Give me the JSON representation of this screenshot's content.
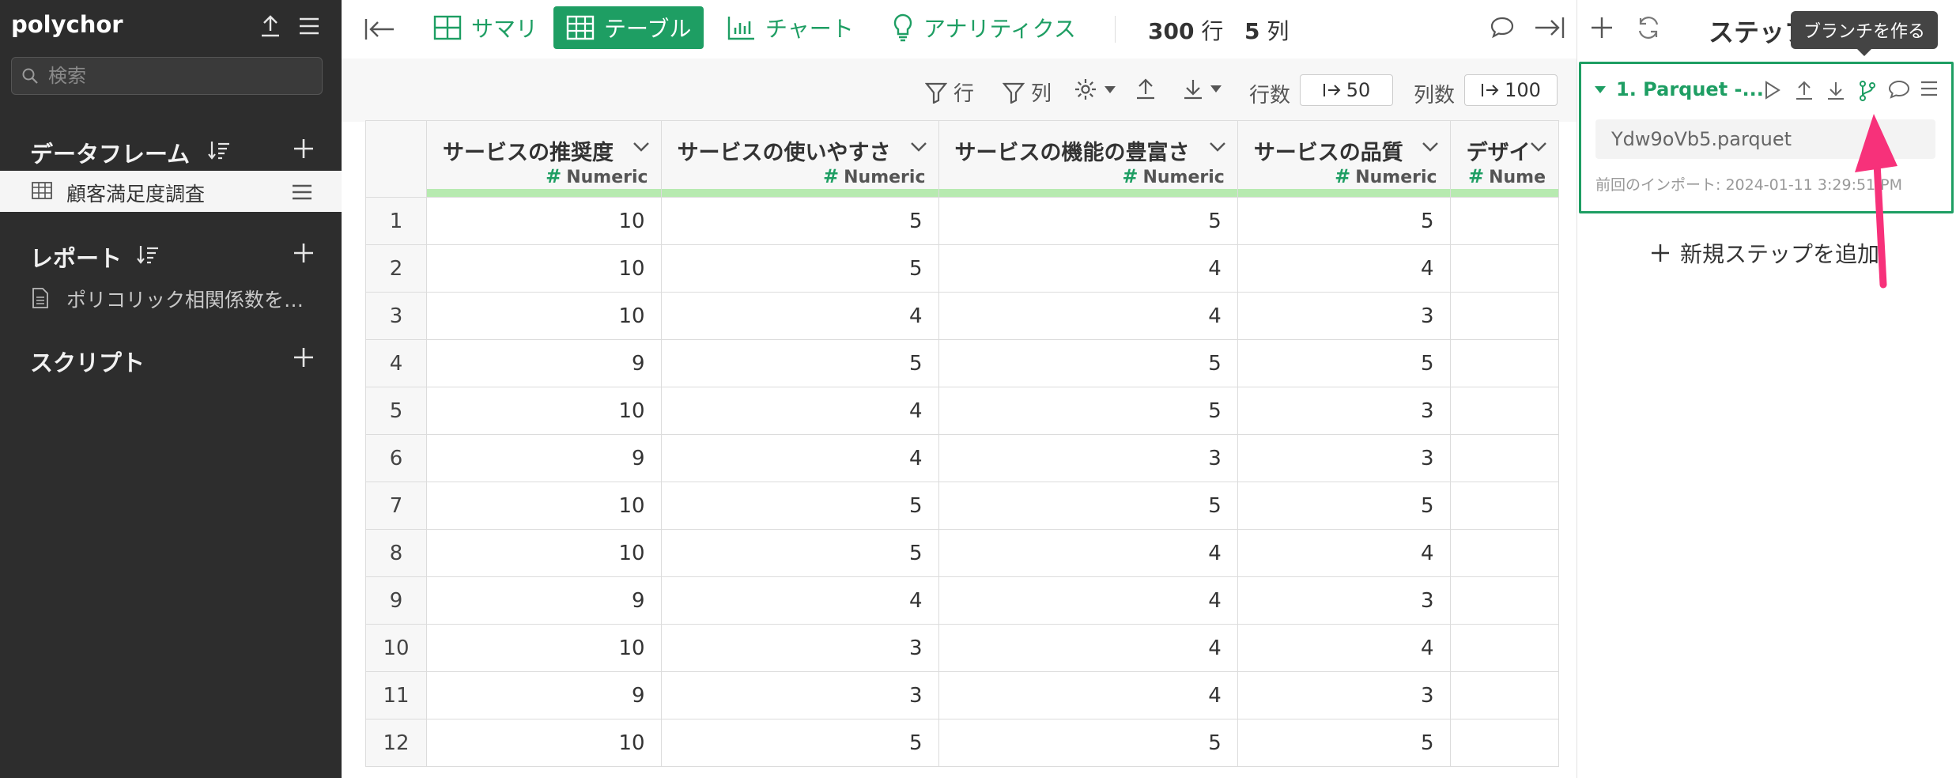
{
  "app": {
    "name": "polychor"
  },
  "sidebar": {
    "search_placeholder": "検索",
    "dataframes": {
      "title": "データフレーム",
      "items": [
        {
          "label": "顧客満足度調査"
        }
      ]
    },
    "reports": {
      "title": "レポート",
      "items": [
        {
          "label": "ポリコリック相関係数を…"
        }
      ]
    },
    "scripts": {
      "title": "スクリプト"
    }
  },
  "tabs": [
    {
      "label": "サマリ",
      "icon": "grid-icon",
      "active": false
    },
    {
      "label": "テーブル",
      "icon": "table-icon",
      "active": true
    },
    {
      "label": "チャート",
      "icon": "bar-chart-icon",
      "active": false
    },
    {
      "label": "アナリティクス",
      "icon": "lightbulb-icon",
      "active": false
    }
  ],
  "stats": {
    "rows_value": "300",
    "rows_unit": "行",
    "cols_value": "5",
    "cols_unit": "列"
  },
  "toolbar": {
    "row_filter": "行",
    "col_filter": "列",
    "rows_label": "行数",
    "rows_value": "50",
    "cols_label": "列数",
    "cols_value": "100"
  },
  "table": {
    "columns": [
      {
        "name": "サービスの推奨度",
        "type": "Numeric"
      },
      {
        "name": "サービスの使いやすさ",
        "type": "Numeric"
      },
      {
        "name": "サービスの機能の豊富さ",
        "type": "Numeric"
      },
      {
        "name": "サービスの品質",
        "type": "Numeric"
      },
      {
        "name": "デザイ",
        "type": "Nume"
      }
    ],
    "type_hash": "#",
    "rows": [
      {
        "index": "1",
        "cells": [
          "10",
          "5",
          "5",
          "5",
          ""
        ]
      },
      {
        "index": "2",
        "cells": [
          "10",
          "5",
          "4",
          "4",
          ""
        ]
      },
      {
        "index": "3",
        "cells": [
          "10",
          "4",
          "4",
          "3",
          ""
        ]
      },
      {
        "index": "4",
        "cells": [
          "9",
          "5",
          "5",
          "5",
          ""
        ]
      },
      {
        "index": "5",
        "cells": [
          "10",
          "4",
          "5",
          "3",
          ""
        ]
      },
      {
        "index": "6",
        "cells": [
          "9",
          "4",
          "3",
          "3",
          ""
        ]
      },
      {
        "index": "7",
        "cells": [
          "10",
          "5",
          "5",
          "5",
          ""
        ]
      },
      {
        "index": "8",
        "cells": [
          "10",
          "5",
          "4",
          "4",
          ""
        ]
      },
      {
        "index": "9",
        "cells": [
          "9",
          "4",
          "4",
          "3",
          ""
        ]
      },
      {
        "index": "10",
        "cells": [
          "10",
          "3",
          "4",
          "4",
          ""
        ]
      },
      {
        "index": "11",
        "cells": [
          "9",
          "3",
          "4",
          "3",
          ""
        ]
      },
      {
        "index": "12",
        "cells": [
          "10",
          "5",
          "5",
          "5",
          ""
        ]
      }
    ]
  },
  "steps_panel": {
    "title": "ステップ",
    "tooltip": "ブランチを作る",
    "step": {
      "title": "1. Parquet -...",
      "file": "Ydw9oVb5.parquet",
      "meta": "前回のインポート: 2024-01-11 3:29:51 PM"
    },
    "add_step": "新規ステップを追加"
  },
  "colors": {
    "accent": "#1e9e63",
    "sidebar_bg": "#2d2d2d",
    "annotation_arrow": "#f7317a",
    "type_bar": "#b7eab0"
  }
}
